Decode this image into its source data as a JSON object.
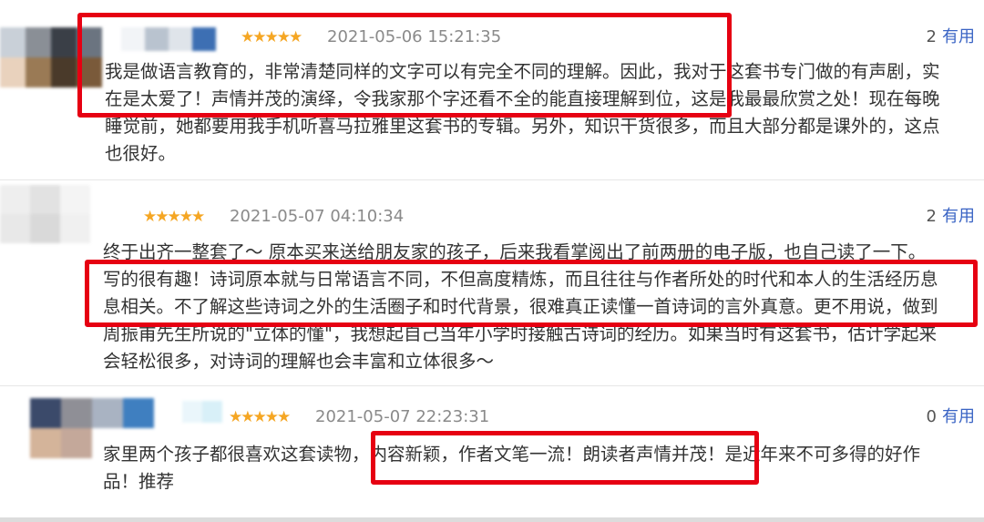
{
  "reviews": [
    {
      "rating_stars": "★★★★★",
      "date": "2021-05-06 15:21:35",
      "useful_count": "2",
      "useful_label": "有用",
      "lines": [
        "我是做语言教育的，非常清楚同样的文字可以有完全不同的理解。因此，我对于这套书专门做的有声剧，实",
        "在是太爱了！声情并茂的演绎，令我家那个字还看不全的能直接理解到位，这是我最最欣赏之处！现在每晚",
        "睡觉前，她都要用我手机听喜马拉雅里这套书的专辑。另外，知识干货很多，而且大部分都是课外的，这点",
        "也很好。"
      ]
    },
    {
      "rating_stars": "★★★★★",
      "date": "2021-05-07 04:10:34",
      "useful_count": "2",
      "useful_label": "有用",
      "lines": [
        "终于出齐一整套了～ 原本买来送给朋友家的孩子，后来我看掌阅出了前两册的电子版，也自己读了一下。",
        "写的很有趣！诗词原本就与日常语言不同，不但高度精炼，而且往往与作者所处的时代和本人的生活经历息",
        "息相关。不了解这些诗词之外的生活圈子和时代背景，很难真正读懂一首诗词的言外真意。更不用说，做到",
        "周振甫先生所说的\"立体的懂\"，我想起自己当年小学时接触古诗词的经历。如果当时有这套书，估计学起来",
        "会轻松很多，对诗词的理解也会丰富和立体很多～"
      ]
    },
    {
      "rating_stars": "★★★★★",
      "date": "2021-05-07 22:23:31",
      "useful_count": "0",
      "useful_label": "有用",
      "lines": [
        "家里两个孩子都很喜欢这套读物，内容新颖，作者文笔一流！朗读者声情并茂！是近年来不可多得的好作",
        "品！推荐"
      ]
    }
  ],
  "colors": {
    "star": "#f5a623",
    "useful_link": "#3a64c4",
    "highlight": "#e60012"
  }
}
